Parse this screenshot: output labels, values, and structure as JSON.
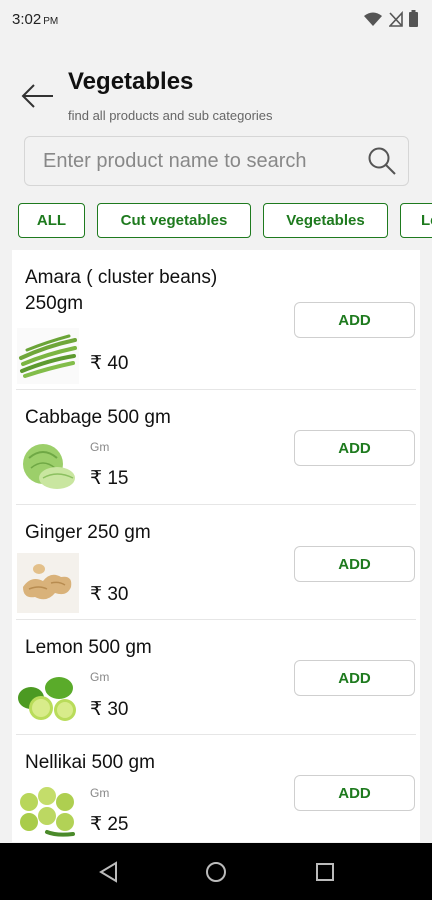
{
  "status_bar": {
    "time": "3:02",
    "ampm": "PM"
  },
  "header": {
    "title": "Vegetables",
    "subtitle": "find all products and sub categories"
  },
  "search": {
    "placeholder": "Enter product name to search"
  },
  "categories": [
    "ALL",
    "Cut vegetables",
    "Vegetables",
    "Le"
  ],
  "products": [
    {
      "name": "Amara ( cluster beans) 250gm",
      "unit": "",
      "price": "₹ 40",
      "add_label": "ADD",
      "image_icon": "cluster-beans-image"
    },
    {
      "name": "Cabbage 500 gm",
      "unit": "Gm",
      "price": "₹ 15",
      "add_label": "ADD",
      "image_icon": "cabbage-image"
    },
    {
      "name": "Ginger 250 gm",
      "unit": "",
      "price": "₹ 30",
      "add_label": "ADD",
      "image_icon": "ginger-image"
    },
    {
      "name": "Lemon 500 gm",
      "unit": "Gm",
      "price": "₹ 30",
      "add_label": "ADD",
      "image_icon": "lemon-image"
    },
    {
      "name": "Nellikai 500 gm",
      "unit": "Gm",
      "price": "₹ 25",
      "add_label": "ADD",
      "image_icon": "gooseberry-image"
    }
  ],
  "colors": {
    "accent_green": "#1e7a1e",
    "background": "#f2f2f2",
    "nav_bar": "#000000"
  }
}
